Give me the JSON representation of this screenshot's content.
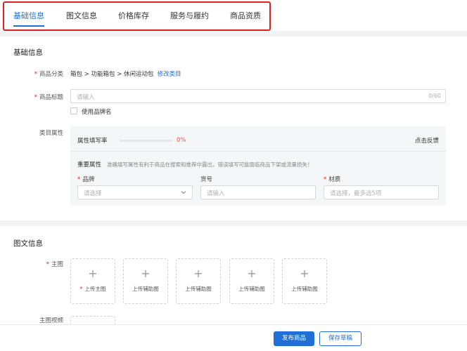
{
  "tabs": [
    {
      "label": "基础信息",
      "active": true
    },
    {
      "label": "图文信息",
      "active": false
    },
    {
      "label": "价格库存",
      "active": false
    },
    {
      "label": "服务与履约",
      "active": false
    },
    {
      "label": "商品资质",
      "active": false
    }
  ],
  "basic": {
    "section_title": "基础信息",
    "category": {
      "label": "商品分类",
      "value": "箱包 > 功能箱包 > 休闲运动包",
      "edit_link": "修改类目"
    },
    "title": {
      "label": "商品标题",
      "placeholder": "请输入",
      "counter": "0/60",
      "brand_checkbox_label": "使用品牌名"
    },
    "attributes": {
      "label": "类目属性",
      "fill_rate_label": "属性填写率",
      "fill_rate_value": "0%",
      "fill_rate_fraction": 0,
      "feedback": "点击反馈",
      "important_title": "重要属性",
      "important_note": "准确填写属性有利于商品在搜索和推荐中露出，错误填写可能面临商品下架或流量损失！",
      "fields": [
        {
          "label": "品牌",
          "required": true,
          "placeholder": "请选择"
        },
        {
          "label": "货号",
          "required": false,
          "placeholder": "请输入"
        },
        {
          "label": "材质",
          "required": true,
          "placeholder": "请选择，最多选5项"
        }
      ]
    }
  },
  "media": {
    "section_title": "图文信息",
    "main_image_label": "主图",
    "upload_main": "上传主图",
    "upload_aux": "上传辅助图",
    "video_label": "主图视频"
  },
  "footer": {
    "publish": "发布商品",
    "save_draft": "保存草稿"
  },
  "colors": {
    "accent": "#1f6fd6",
    "required": "#e02020",
    "highlight_box": "#e02020"
  }
}
